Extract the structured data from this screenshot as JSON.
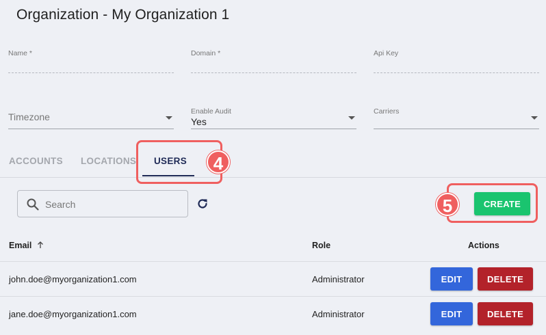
{
  "page": {
    "title": "Organization - My Organization 1"
  },
  "form": {
    "name": {
      "label": "Name *",
      "value": ""
    },
    "domain": {
      "label": "Domain *",
      "value": ""
    },
    "api_key": {
      "label": "Api Key",
      "value": ""
    },
    "timezone": {
      "placeholder": "Timezone"
    },
    "enable_audit": {
      "label": "Enable Audit",
      "value": "Yes"
    },
    "carriers": {
      "label": "Carriers",
      "value": ""
    }
  },
  "tabs": [
    {
      "label": "ACCOUNTS"
    },
    {
      "label": "LOCATIONS"
    },
    {
      "label": "USERS",
      "active": true
    }
  ],
  "callouts": {
    "tabs_step": "4",
    "create_step": "5",
    "color": "#ef5f5f"
  },
  "toolbar": {
    "search_placeholder": "Search",
    "create_label": "CREATE"
  },
  "table": {
    "headers": {
      "email": "Email",
      "role": "Role",
      "actions": "Actions"
    },
    "rows": [
      {
        "email": "john.doe@myorganization1.com",
        "role": "Administrator",
        "edit": "EDIT",
        "delete": "DELETE"
      },
      {
        "email": "jane.doe@myorganization1.com",
        "role": "Administrator",
        "edit": "EDIT",
        "delete": "DELETE"
      }
    ]
  },
  "colors": {
    "accent": "#1f2a56",
    "create": "#1ac46f",
    "edit": "#3366db",
    "delete": "#b3222a"
  }
}
